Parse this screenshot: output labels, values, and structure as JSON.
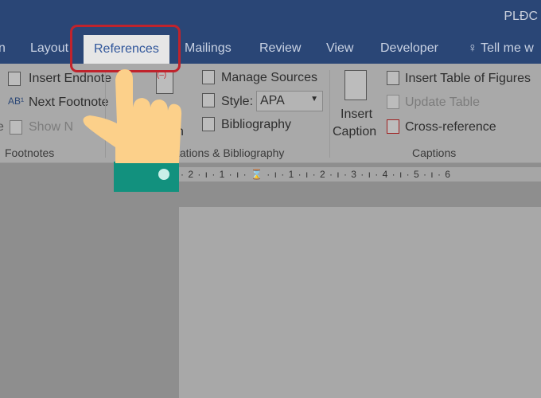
{
  "title": "PLĐC",
  "tabs": [
    {
      "label": "n"
    },
    {
      "label": "Layout"
    },
    {
      "label": "References",
      "active": true
    },
    {
      "label": "Mailings"
    },
    {
      "label": "Review"
    },
    {
      "label": "View"
    },
    {
      "label": "Developer"
    },
    {
      "label": "Tell me w"
    }
  ],
  "footnotes": {
    "insert_endnote": "Insert Endnote",
    "next_footnote": "Next Footnote",
    "show_notes": "Show N",
    "left_fragment": "e",
    "group": "Footnotes"
  },
  "citations": {
    "insert_citation_fragment1": "t",
    "insert_citation_fragment2": "n",
    "manage_sources": "Manage Sources",
    "style_label": "Style:",
    "style_value": "APA",
    "bibliography": "Bibliography",
    "group": "tations & Bibliography"
  },
  "captions": {
    "insert_caption_1": "Insert",
    "insert_caption_2": "Caption",
    "insert_table_of_figures": "Insert Table of Figures",
    "update_table": "Update Table",
    "cross_reference": "Cross-reference",
    "group": "Captions"
  },
  "ruler": {
    "marks": "· 2 · ı · 1 · ı · ⌛ · ı · 1 · ı · 2 · ı · 3 · ı · 4 · ı · 5 · ı · 6"
  },
  "colors": {
    "titlebar": "#2a4676",
    "highlight": "#c0232c",
    "hand": "#fcd08a",
    "sleeve": "#12917e"
  }
}
